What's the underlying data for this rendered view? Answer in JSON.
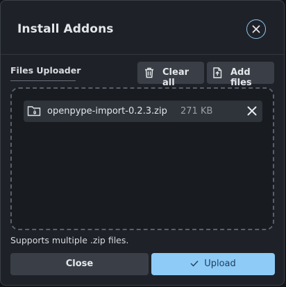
{
  "dialog": {
    "title": "Install Addons"
  },
  "uploader": {
    "section_label": "Files Uploader",
    "clear_all_label": "Clear all",
    "add_files_label": "Add files",
    "hint": "Supports multiple .zip files.",
    "files": [
      {
        "name": "openpype-import-0.2.3.zip",
        "size": "271 KB"
      }
    ]
  },
  "footer": {
    "close_label": "Close",
    "upload_label": "Upload"
  },
  "colors": {
    "accent": "#8ecbf7",
    "dialog_bg": "#1e2228",
    "button_bg": "#3a3f47"
  }
}
